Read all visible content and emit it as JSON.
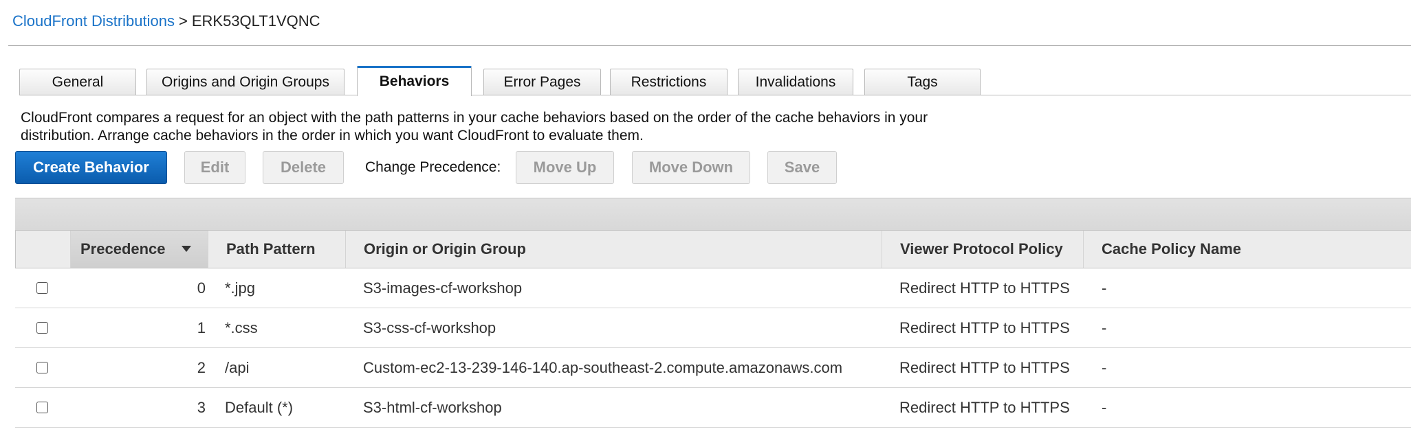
{
  "breadcrumb": {
    "parent": "CloudFront Distributions",
    "separator": ">",
    "current": "ERK53QLT1VQNC"
  },
  "tabs": [
    {
      "label": "General",
      "active": false
    },
    {
      "label": "Origins and Origin Groups",
      "active": false
    },
    {
      "label": "Behaviors",
      "active": true
    },
    {
      "label": "Error Pages",
      "active": false
    },
    {
      "label": "Restrictions",
      "active": false
    },
    {
      "label": "Invalidations",
      "active": false
    },
    {
      "label": "Tags",
      "active": false
    }
  ],
  "description": "CloudFront compares a request for an object with the path patterns in your cache behaviors based on the order of the cache behaviors in your distribution. Arrange cache behaviors in the order in which you want CloudFront to evaluate them.",
  "toolbar": {
    "create": "Create Behavior",
    "edit": "Edit",
    "delete": "Delete",
    "change_precedence": "Change Precedence:",
    "move_up": "Move Up",
    "move_down": "Move Down",
    "save": "Save"
  },
  "table": {
    "columns": [
      "Precedence",
      "Path Pattern",
      "Origin or Origin Group",
      "Viewer Protocol Policy",
      "Cache Policy Name"
    ],
    "sorted_column": "Precedence",
    "sort_direction": "descending-arrow",
    "rows": [
      {
        "precedence": "0",
        "path": "*.jpg",
        "origin": "S3-images-cf-workshop",
        "viewer_policy": "Redirect HTTP to HTTPS",
        "cache_policy": "-",
        "checked": false
      },
      {
        "precedence": "1",
        "path": "*.css",
        "origin": "S3-css-cf-workshop",
        "viewer_policy": "Redirect HTTP to HTTPS",
        "cache_policy": "-",
        "checked": false
      },
      {
        "precedence": "2",
        "path": "/api",
        "origin": "Custom-ec2-13-239-146-140.ap-southeast-2.compute.amazonaws.com",
        "viewer_policy": "Redirect HTTP to HTTPS",
        "cache_policy": "-",
        "checked": false
      },
      {
        "precedence": "3",
        "path": "Default (*)",
        "origin": "S3-html-cf-workshop",
        "viewer_policy": "Redirect HTTP to HTTPS",
        "cache_policy": "-",
        "checked": false
      }
    ]
  },
  "colors": {
    "link": "#1a73c8",
    "primary_button": "#0b5cad",
    "active_tab_accent": "#1a73c8",
    "disabled_text": "#9a9a9a"
  }
}
